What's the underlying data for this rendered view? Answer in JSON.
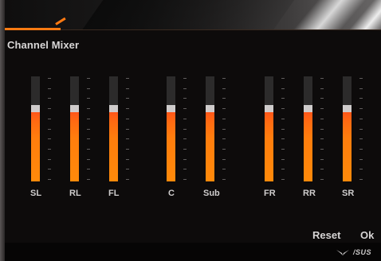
{
  "window": {
    "section_title": "Channel Mixer"
  },
  "channels": [
    {
      "label": "SL",
      "level": 0.7
    },
    {
      "label": "RL",
      "level": 0.7
    },
    {
      "label": "FL",
      "level": 0.7
    },
    {
      "label": "C",
      "level": 0.7
    },
    {
      "label": "Sub",
      "level": 0.7
    },
    {
      "label": "FR",
      "level": 0.7
    },
    {
      "label": "RR",
      "level": 0.7
    },
    {
      "label": "SR",
      "level": 0.7
    }
  ],
  "buttons": {
    "reset_label": "Reset",
    "ok_label": "Ok"
  },
  "brand": {
    "logo_text": "/SUS",
    "icon": "rog-eye-icon"
  },
  "colors": {
    "accent": "#ff7a12",
    "track": "#2c2b2b",
    "thumb": "#cfcccc"
  }
}
